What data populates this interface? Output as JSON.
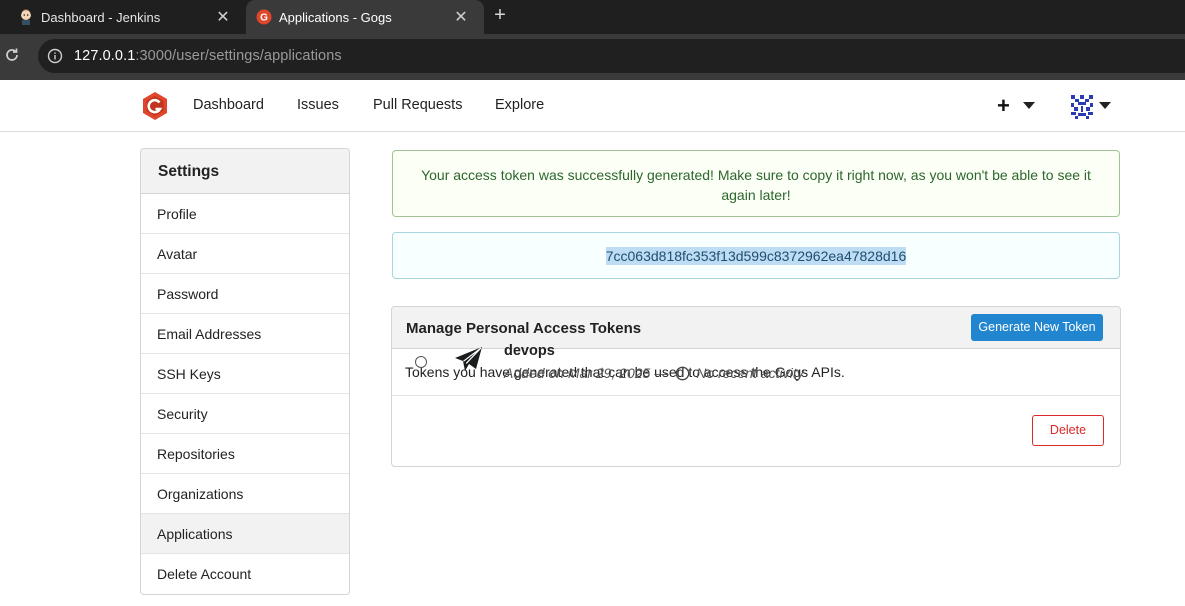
{
  "browser": {
    "tabs": [
      {
        "title": "Dashboard - Jenkins",
        "active": false
      },
      {
        "title": "Applications - Gogs",
        "active": true
      }
    ],
    "url_host": "127.0.0.1",
    "url_rest": ":3000/user/settings/applications"
  },
  "nav": {
    "items": [
      "Dashboard",
      "Issues",
      "Pull Requests",
      "Explore"
    ],
    "plus": "+"
  },
  "sidebar": {
    "heading": "Settings",
    "items": [
      {
        "label": "Profile"
      },
      {
        "label": "Avatar"
      },
      {
        "label": "Password"
      },
      {
        "label": "Email Addresses"
      },
      {
        "label": "SSH Keys"
      },
      {
        "label": "Security"
      },
      {
        "label": "Repositories"
      },
      {
        "label": "Organizations"
      },
      {
        "label": "Applications",
        "active": true
      },
      {
        "label": "Delete Account"
      }
    ]
  },
  "main": {
    "success_message": "Your access token was successfully generated! Make sure to copy it right now, as you won't be able to see it again later!",
    "token_value": "7cc063d818fc353f13d599c8372962ea47828d16",
    "panel_title": "Manage Personal Access Tokens",
    "generate_button": "Generate New Token",
    "description": "Tokens you have generated that can be used to access the Gogs APIs.",
    "tokens": [
      {
        "name": "devops",
        "added": "Added on Mar 29, 2025 —",
        "activity": "No recent activity",
        "delete_label": "Delete"
      }
    ]
  },
  "colors": {
    "primary": "#2185d0",
    "danger": "#db2828",
    "success_text": "#2c662d",
    "info_text": "#276f86",
    "logo": "#e0462b"
  }
}
